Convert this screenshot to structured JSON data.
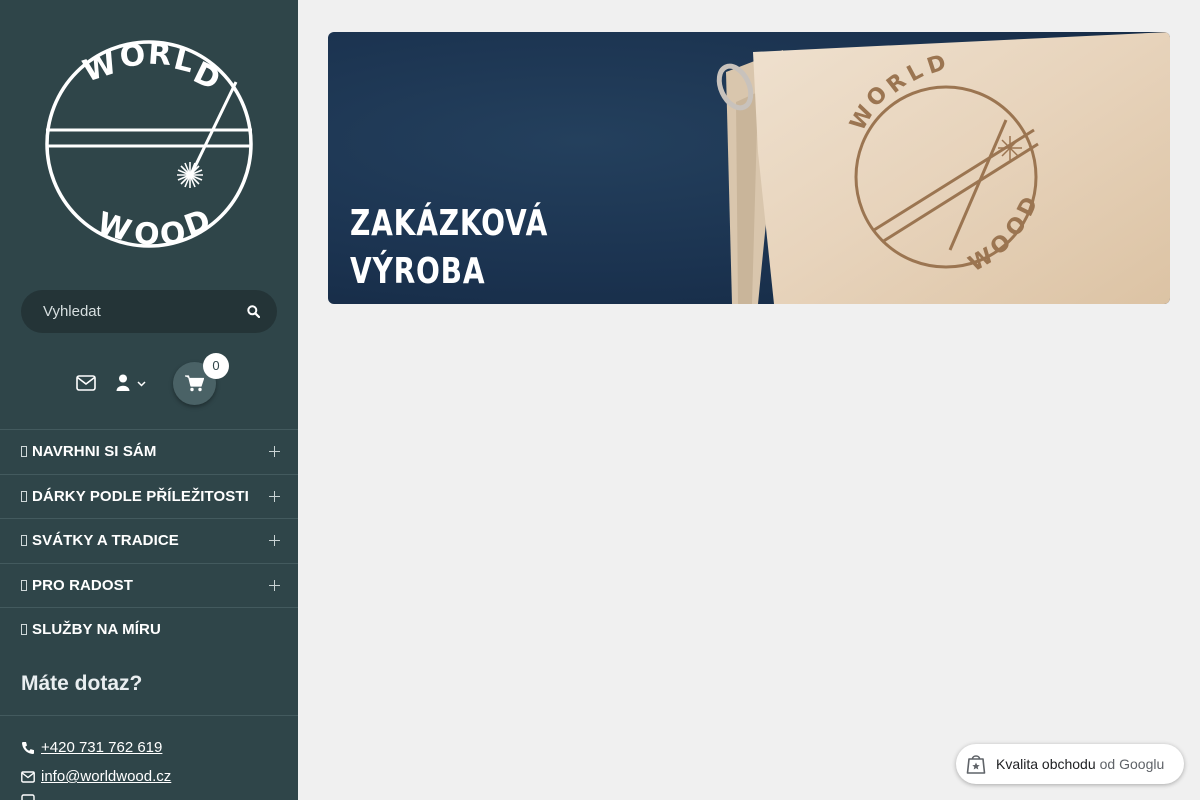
{
  "brand": {
    "logo_top": "WORLD",
    "logo_bottom": "WOOD"
  },
  "search": {
    "placeholder": "Vyhledat"
  },
  "cart": {
    "count": "0"
  },
  "menu": {
    "items": [
      {
        "label": "NAVRHNI SI SÁM",
        "expandable": true
      },
      {
        "label": "DÁRKY PODLE PŘÍLEŽITOSTI",
        "expandable": true
      },
      {
        "label": "SVÁTKY A TRADICE",
        "expandable": true
      },
      {
        "label": "PRO RADOST",
        "expandable": true
      },
      {
        "label": "SLUŽBY NA MÍRU",
        "expandable": false
      }
    ]
  },
  "contact": {
    "title": "Máte dotaz?",
    "phone": "+420 731 762 619",
    "email": "info@worldwood.cz"
  },
  "banner": {
    "title_line1": "ZAKÁZKOVÁ",
    "title_line2": "VÝROBA",
    "box_text_top": "WORLD",
    "box_text_bottom": "WOOD"
  },
  "google_badge": {
    "label": "Kvalita obchodu",
    "sub": "od Googlu"
  },
  "colors": {
    "sidebar": "#2f4549",
    "background": "#f0f0f0",
    "banner": "#1b3350"
  }
}
